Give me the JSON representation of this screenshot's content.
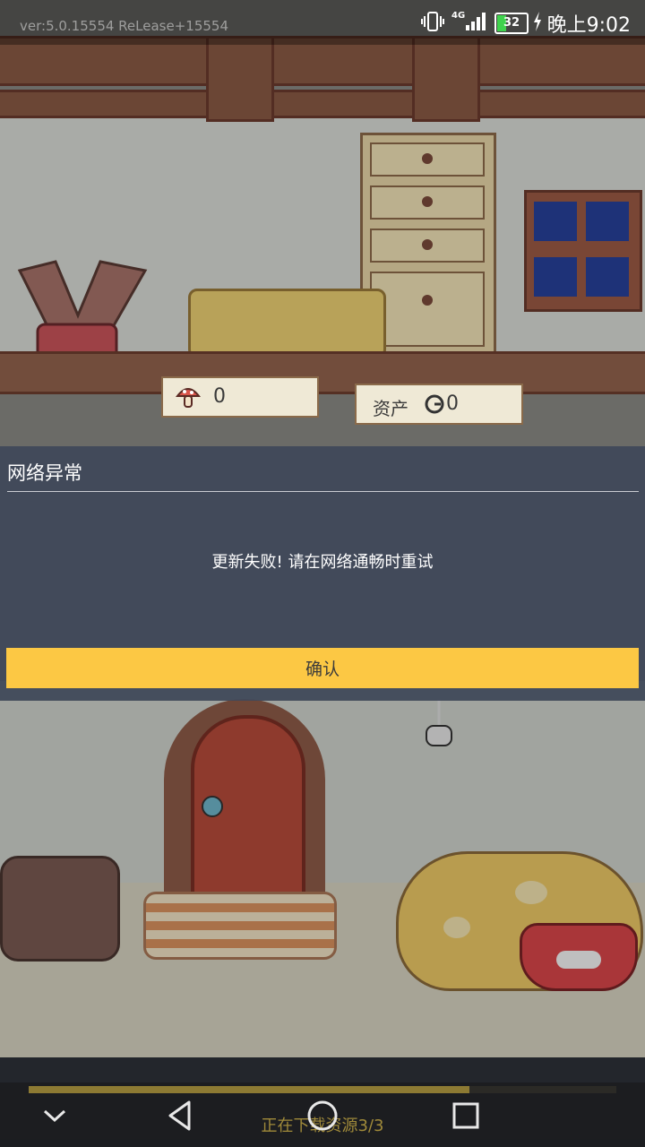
{
  "status_bar": {
    "version_text": "ver:5.0.15554 ReLease+15554",
    "network_type": "4G",
    "battery_level": "32",
    "battery_fraction": 0.32,
    "clock": "晚上9:02"
  },
  "hud": {
    "mushroom_count": "0",
    "asset_label": "资产",
    "asset_count": "0"
  },
  "dialog": {
    "title": "网络异常",
    "message": "更新失败! 请在网络通畅时重试",
    "confirm_label": "确认"
  },
  "loading": {
    "text": "正在下载资源3/3",
    "progress": 0.75
  },
  "nav_icons": [
    "chevron-down-icon",
    "back-triangle-icon",
    "home-circle-icon",
    "recents-square-icon"
  ],
  "colors": {
    "dialog_bg": "#404858",
    "confirm_button": "#fcc844",
    "progress_fill": "#8d7a33"
  }
}
